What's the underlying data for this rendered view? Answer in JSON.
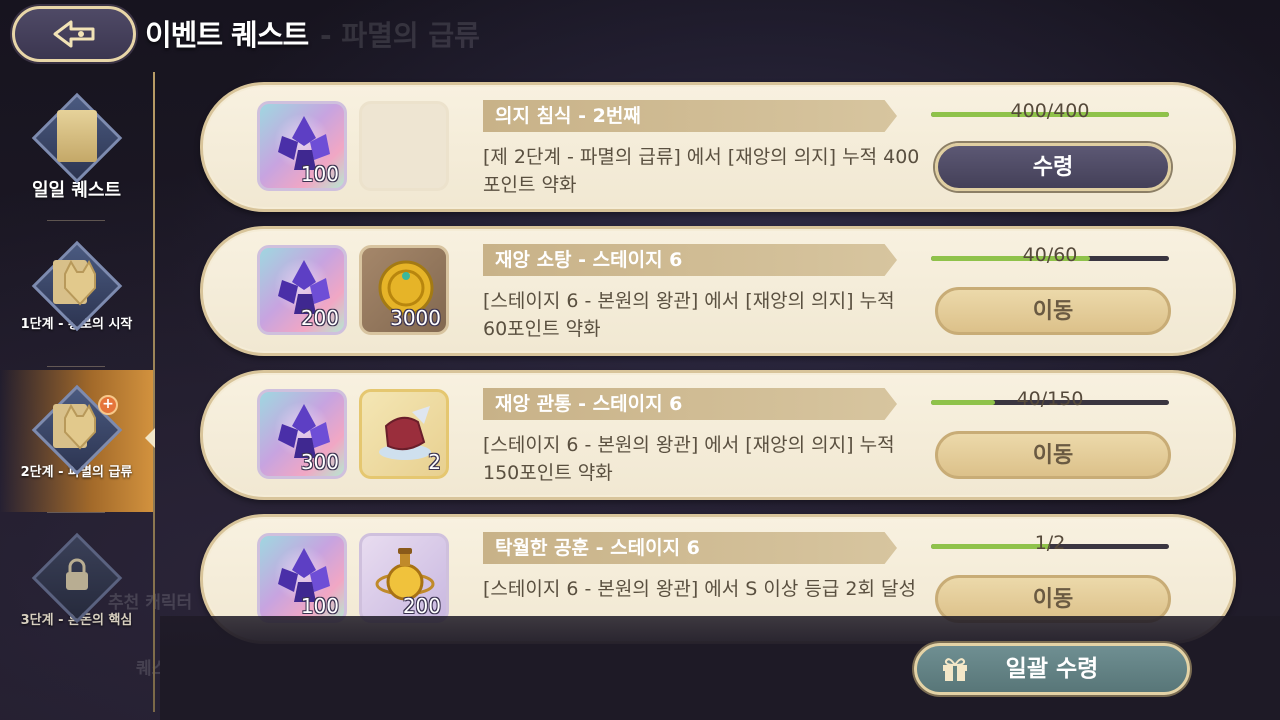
{
  "header": {
    "title": "이벤트 퀘스트",
    "ghost_title": "- 파멸의 급류"
  },
  "sidebar": {
    "items": [
      {
        "label": "일일 퀘스트",
        "icon": "scroll-icon",
        "state": "normal"
      },
      {
        "label": "1단계 - 황로의 시작",
        "icon": "fox-icon",
        "state": "normal"
      },
      {
        "label": "2단계 - 파멸의 급류",
        "icon": "fox-icon",
        "state": "active"
      },
      {
        "label": "3단계 - 혼돈의 핵심",
        "icon": "lock-icon",
        "state": "locked"
      }
    ]
  },
  "ghost_text": {
    "recommend": "추천 캐릭터",
    "quest_list": "퀘스트 목록"
  },
  "quests": [
    {
      "title": "의지 침식 - 2번째",
      "desc": "[제 2단계 - 파멸의 급류] 에서 [재앙의 의지] 누적 400포인트 약화",
      "reward1_qty": "100",
      "reward2_qty": "",
      "reward2_type": "empty",
      "progress_text": "400/400",
      "progress": 1.0,
      "button": "수령",
      "button_type": "claim"
    },
    {
      "title": "재앙 소탕 - 스테이지 6",
      "desc": "[스테이지 6 - 본원의 왕관] 에서 [재앙의 의지] 누적 60포인트 약화",
      "reward1_qty": "200",
      "reward2_qty": "3000",
      "reward2_type": "coin",
      "progress_text": "40/60",
      "progress": 0.667,
      "button": "이동",
      "button_type": "move"
    },
    {
      "title": "재앙 관통 - 스테이지 6",
      "desc": "[스테이지 6 - 본원의 왕관] 에서 [재앙의 의지] 누적 150포인트 약화",
      "reward1_qty": "300",
      "reward2_qty": "2",
      "reward2_type": "cloak",
      "progress_text": "40/150",
      "progress": 0.267,
      "button": "이동",
      "button_type": "move"
    },
    {
      "title": "탁월한 공훈 - 스테이지 6",
      "desc": "[스테이지 6 - 본원의 왕관] 에서 S 이상 등급 2회 달성",
      "reward1_qty": "100",
      "reward2_qty": "200",
      "reward2_type": "potion",
      "progress_text": "1/2",
      "progress": 0.5,
      "button": "이동",
      "button_type": "move"
    }
  ],
  "footer": {
    "claim_all": "일괄 수령"
  },
  "colors": {
    "progress_fill": "#8fc24a",
    "claim_button": "#4e4a66",
    "move_button": "#e4cd98",
    "claim_all_button": "#62827f"
  }
}
